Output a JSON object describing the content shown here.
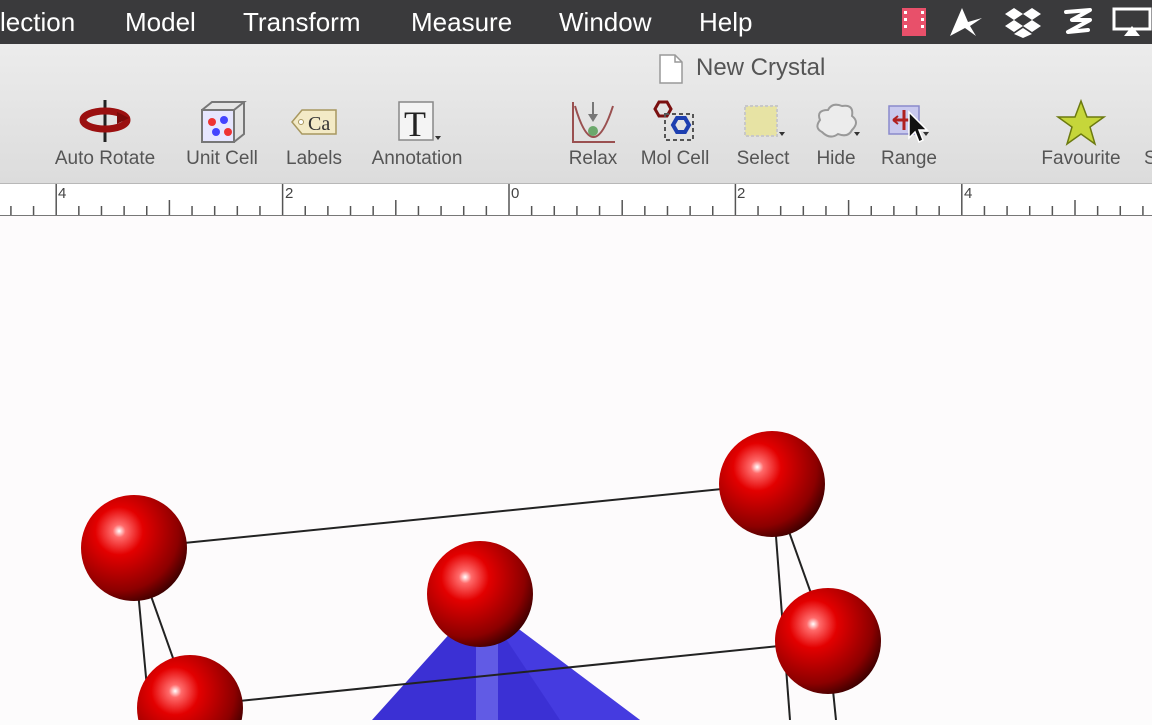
{
  "menubar": {
    "items": [
      "lection",
      "Model",
      "Transform",
      "Measure",
      "Window",
      "Help"
    ],
    "status_icons": [
      "record-icon",
      "send-icon",
      "dropbox-icon",
      "z-app-icon",
      "airplay-icon"
    ]
  },
  "document": {
    "title": "New Crystal",
    "icon": "document-icon"
  },
  "toolbar": {
    "tools": [
      {
        "label": "Auto Rotate",
        "icon": "auto-rotate-icon"
      },
      {
        "label": "Unit Cell",
        "icon": "unit-cell-icon"
      },
      {
        "label": "Labels",
        "icon": "labels-tag-icon",
        "tag": "Ca"
      },
      {
        "label": "Annotation",
        "icon": "annotation-icon",
        "glyph": "T"
      },
      {
        "label": "Relax",
        "icon": "relax-icon"
      },
      {
        "label": "Mol Cell",
        "icon": "mol-cell-icon"
      },
      {
        "label": "Select",
        "icon": "select-icon"
      },
      {
        "label": "Hide",
        "icon": "hide-icon"
      },
      {
        "label": "Range",
        "icon": "range-icon"
      },
      {
        "label": "Favourite",
        "icon": "star-icon"
      }
    ],
    "cut_label": "S"
  },
  "ruler": {
    "labels": [
      "4",
      "2",
      "0",
      "2",
      "4"
    ]
  },
  "colors": {
    "atom": "#e00000",
    "polyhedron": "#3a2fd6",
    "menubar": "#3a3a3c",
    "toolbar": "#e4e4e4"
  }
}
